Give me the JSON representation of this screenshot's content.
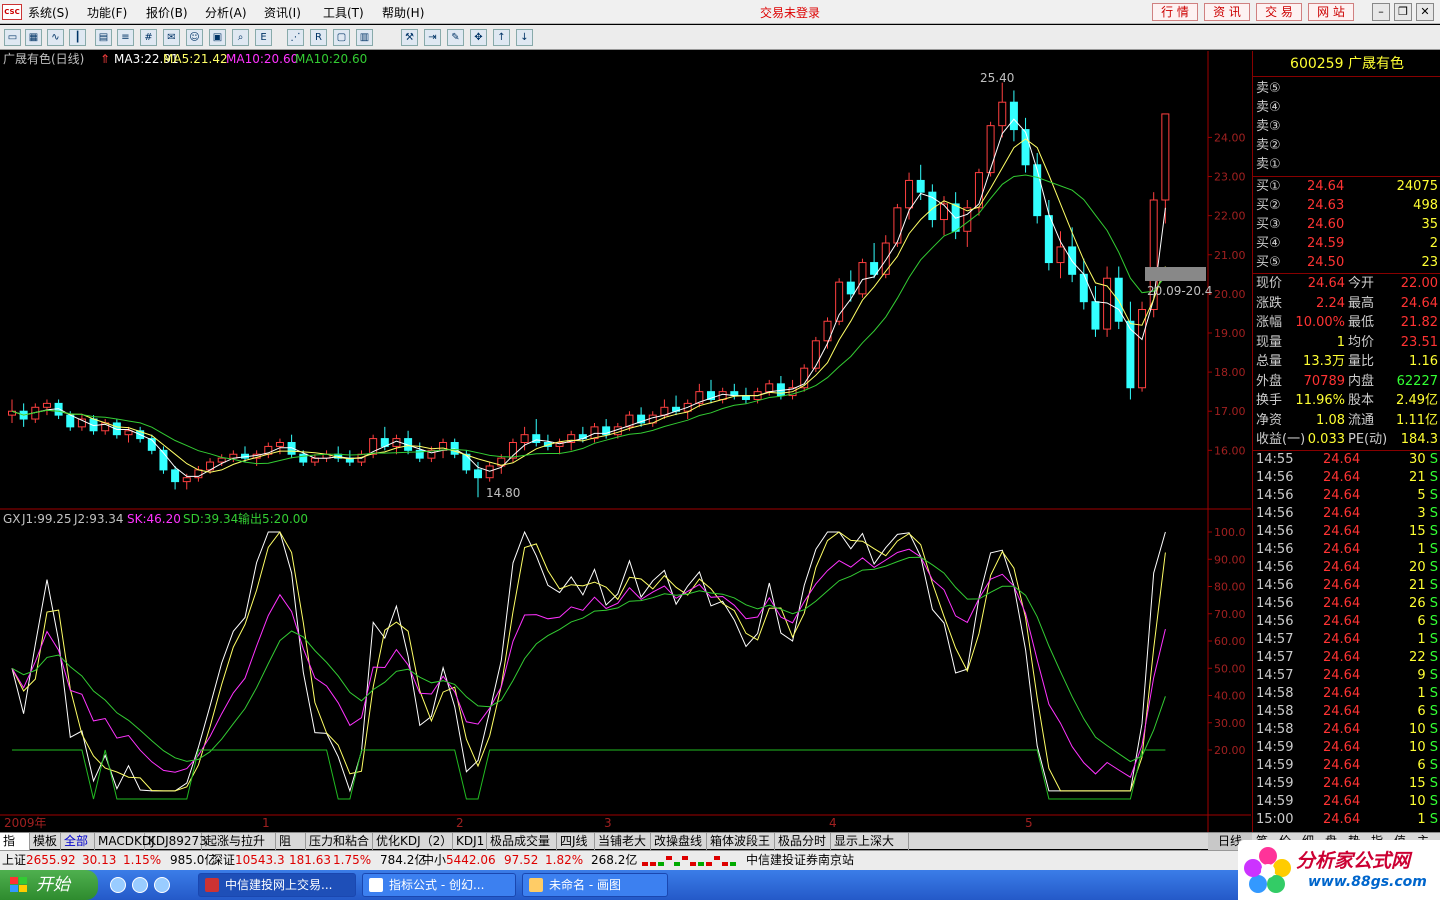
{
  "menu": {
    "logo": "CSC",
    "items": [
      "系统(S)",
      "功能(F)",
      "报价(B)",
      "分析(A)",
      "资讯(I)",
      "工具(T)",
      "帮助(H)"
    ],
    "center_title": "交易未登录",
    "right_buttons": [
      "行 情",
      "资 讯",
      "交 易",
      "网 站"
    ]
  },
  "main_chart": {
    "title": "广晟有色(日线)",
    "ma3": "MA3:22.91",
    "ma5": "MA5:21.42",
    "ma10a": "MA10:20.60",
    "ma10b": "MA10:20.60",
    "high_label": "25.40",
    "low_label": "14.80",
    "box_label": "20.09-20.4",
    "y_ticks": [
      "24.00",
      "23.00",
      "22.00",
      "21.00",
      "20.00",
      "19.00",
      "18.00",
      "17.00",
      "16.00"
    ],
    "colors": {
      "ma3": "#ffffff",
      "ma5": "#ffff66",
      "ma10a": "#ff33ff",
      "ma10b": "#33cc33",
      "up": "#ff4040",
      "down": "#33ffff"
    }
  },
  "sub_chart": {
    "title": "GX",
    "j1": "J1:99.25",
    "j2": "J2:93.34",
    "sk": "SK:46.20",
    "sd": "SD:39.34",
    "out": "输出5:20.00",
    "y_ticks": [
      "100.0",
      "90.00",
      "80.00",
      "70.00",
      "60.00",
      "50.00",
      "40.00",
      "30.00",
      "20.00"
    ]
  },
  "x_axis": {
    "labels": [
      "2009年",
      "1",
      "2",
      "3",
      "4",
      "5"
    ]
  },
  "chart_data": {
    "type": "candlestick",
    "title": "广晟有色(日线)",
    "ylim": [
      14.5,
      25.8
    ],
    "high": 25.4,
    "low": 14.8,
    "ohlc": [
      [
        16.9,
        17.3,
        16.7,
        17.0
      ],
      [
        17.0,
        17.2,
        16.6,
        16.8
      ],
      [
        16.8,
        17.2,
        16.7,
        17.1
      ],
      [
        17.1,
        17.3,
        16.9,
        17.2
      ],
      [
        17.2,
        17.3,
        16.8,
        16.9
      ],
      [
        16.9,
        17.0,
        16.5,
        16.6
      ],
      [
        16.6,
        16.9,
        16.5,
        16.8
      ],
      [
        16.8,
        16.9,
        16.4,
        16.5
      ],
      [
        16.5,
        16.8,
        16.4,
        16.7
      ],
      [
        16.7,
        16.8,
        16.3,
        16.4
      ],
      [
        16.4,
        16.6,
        16.2,
        16.5
      ],
      [
        16.5,
        16.6,
        16.2,
        16.3
      ],
      [
        16.3,
        16.4,
        15.9,
        16.0
      ],
      [
        16.0,
        16.1,
        15.4,
        15.5
      ],
      [
        15.5,
        15.6,
        15.0,
        15.2
      ],
      [
        15.2,
        15.4,
        15.0,
        15.3
      ],
      [
        15.3,
        15.6,
        15.2,
        15.5
      ],
      [
        15.5,
        15.8,
        15.4,
        15.7
      ],
      [
        15.7,
        15.9,
        15.6,
        15.8
      ],
      [
        15.8,
        16.0,
        15.7,
        15.9
      ],
      [
        15.9,
        16.1,
        15.7,
        15.8
      ],
      [
        15.8,
        16.0,
        15.6,
        15.9
      ],
      [
        15.9,
        16.2,
        15.8,
        16.1
      ],
      [
        16.1,
        16.3,
        15.9,
        16.2
      ],
      [
        16.2,
        16.4,
        15.8,
        15.9
      ],
      [
        15.9,
        16.0,
        15.6,
        15.7
      ],
      [
        15.7,
        15.9,
        15.6,
        15.8
      ],
      [
        15.8,
        16.0,
        15.7,
        15.9
      ],
      [
        15.9,
        16.1,
        15.7,
        15.8
      ],
      [
        15.8,
        16.0,
        15.6,
        15.7
      ],
      [
        15.7,
        16.0,
        15.6,
        15.9
      ],
      [
        15.9,
        16.4,
        15.8,
        16.3
      ],
      [
        16.3,
        16.6,
        16.0,
        16.1
      ],
      [
        16.1,
        16.4,
        15.9,
        16.3
      ],
      [
        16.3,
        16.5,
        15.9,
        16.0
      ],
      [
        16.0,
        16.2,
        15.7,
        15.8
      ],
      [
        15.8,
        16.1,
        15.7,
        16.0
      ],
      [
        16.0,
        16.3,
        15.8,
        16.2
      ],
      [
        16.2,
        16.3,
        15.8,
        15.9
      ],
      [
        15.9,
        16.0,
        15.4,
        15.5
      ],
      [
        15.5,
        15.7,
        14.8,
        15.3
      ],
      [
        15.3,
        15.7,
        15.2,
        15.6
      ],
      [
        15.6,
        15.9,
        15.4,
        15.8
      ],
      [
        15.8,
        16.3,
        15.7,
        16.2
      ],
      [
        16.2,
        16.6,
        16.0,
        16.4
      ],
      [
        16.4,
        16.8,
        16.1,
        16.2
      ],
      [
        16.2,
        16.4,
        16.0,
        16.1
      ],
      [
        16.1,
        16.3,
        15.9,
        16.2
      ],
      [
        16.2,
        16.5,
        16.0,
        16.4
      ],
      [
        16.4,
        16.6,
        16.2,
        16.3
      ],
      [
        16.3,
        16.7,
        16.2,
        16.6
      ],
      [
        16.6,
        16.8,
        16.3,
        16.4
      ],
      [
        16.4,
        16.7,
        16.3,
        16.6
      ],
      [
        16.6,
        17.0,
        16.5,
        16.9
      ],
      [
        16.9,
        17.1,
        16.6,
        16.7
      ],
      [
        16.7,
        17.0,
        16.6,
        16.9
      ],
      [
        16.9,
        17.3,
        16.8,
        17.1
      ],
      [
        17.1,
        17.4,
        16.9,
        17.0
      ],
      [
        17.0,
        17.3,
        16.8,
        17.2
      ],
      [
        17.2,
        17.7,
        17.1,
        17.5
      ],
      [
        17.5,
        17.8,
        17.2,
        17.3
      ],
      [
        17.3,
        17.6,
        17.2,
        17.5
      ],
      [
        17.5,
        17.7,
        17.3,
        17.4
      ],
      [
        17.4,
        17.6,
        17.2,
        17.3
      ],
      [
        17.3,
        17.6,
        17.2,
        17.5
      ],
      [
        17.5,
        17.8,
        17.4,
        17.7
      ],
      [
        17.7,
        17.9,
        17.3,
        17.4
      ],
      [
        17.4,
        17.8,
        17.3,
        17.6
      ],
      [
        17.6,
        18.2,
        17.5,
        18.1
      ],
      [
        18.1,
        18.9,
        18.0,
        18.8
      ],
      [
        18.8,
        19.4,
        18.6,
        19.3
      ],
      [
        19.3,
        20.4,
        19.2,
        20.3
      ],
      [
        20.3,
        20.6,
        19.8,
        20.0
      ],
      [
        20.0,
        20.9,
        19.9,
        20.8
      ],
      [
        20.8,
        21.3,
        20.4,
        20.5
      ],
      [
        20.5,
        21.5,
        20.4,
        21.3
      ],
      [
        21.3,
        22.3,
        21.2,
        22.2
      ],
      [
        22.2,
        23.1,
        21.9,
        22.9
      ],
      [
        22.9,
        23.3,
        22.4,
        22.6
      ],
      [
        22.6,
        22.8,
        21.7,
        21.9
      ],
      [
        21.9,
        22.5,
        21.5,
        22.3
      ],
      [
        22.3,
        22.6,
        21.4,
        21.6
      ],
      [
        21.6,
        22.4,
        21.2,
        22.2
      ],
      [
        22.2,
        23.2,
        22.0,
        23.1
      ],
      [
        23.1,
        24.4,
        23.0,
        24.3
      ],
      [
        24.3,
        25.4,
        24.0,
        24.9
      ],
      [
        24.9,
        25.2,
        23.9,
        24.2
      ],
      [
        24.2,
        24.5,
        23.1,
        23.3
      ],
      [
        23.3,
        23.6,
        21.8,
        22.0
      ],
      [
        22.0,
        22.4,
        20.6,
        20.8
      ],
      [
        20.8,
        21.6,
        20.4,
        21.2
      ],
      [
        21.2,
        21.7,
        20.3,
        20.5
      ],
      [
        20.5,
        20.9,
        19.6,
        19.8
      ],
      [
        19.8,
        20.2,
        18.9,
        19.1
      ],
      [
        19.1,
        20.7,
        18.9,
        20.4
      ],
      [
        20.4,
        20.7,
        19.1,
        19.3
      ],
      [
        19.3,
        19.8,
        17.3,
        17.6
      ],
      [
        17.6,
        19.8,
        17.5,
        19.6
      ],
      [
        19.6,
        22.6,
        19.4,
        22.4
      ],
      [
        22.4,
        24.6,
        21.8,
        24.6
      ]
    ]
  },
  "quote": {
    "code_name": "600259 广晟有色",
    "sell": [
      {
        "label": "卖⑤",
        "price": "",
        "vol": ""
      },
      {
        "label": "卖④",
        "price": "",
        "vol": ""
      },
      {
        "label": "卖③",
        "price": "",
        "vol": ""
      },
      {
        "label": "卖②",
        "price": "",
        "vol": ""
      },
      {
        "label": "卖①",
        "price": "",
        "vol": ""
      }
    ],
    "buy": [
      {
        "label": "买①",
        "price": "24.64",
        "vol": "24075"
      },
      {
        "label": "买②",
        "price": "24.63",
        "vol": "498"
      },
      {
        "label": "买③",
        "price": "24.60",
        "vol": "35"
      },
      {
        "label": "买④",
        "price": "24.59",
        "vol": "2"
      },
      {
        "label": "买⑤",
        "price": "24.50",
        "vol": "23"
      }
    ],
    "stats": [
      {
        "l1": "现价",
        "v1": "24.64",
        "c1": "#ff3333",
        "l2": "今开",
        "v2": "22.00",
        "c2": "#ff3333"
      },
      {
        "l1": "涨跌",
        "v1": "2.24",
        "c1": "#ff3333",
        "l2": "最高",
        "v2": "24.64",
        "c2": "#ff3333"
      },
      {
        "l1": "涨幅",
        "v1": "10.00%",
        "c1": "#ff3333",
        "l2": "最低",
        "v2": "21.82",
        "c2": "#ff3333"
      },
      {
        "l1": "现量",
        "v1": "1",
        "c1": "#ffff33",
        "l2": "均价",
        "v2": "23.51",
        "c2": "#ff3333"
      },
      {
        "l1": "总量",
        "v1": "13.3万",
        "c1": "#ffff33",
        "l2": "量比",
        "v2": "1.16",
        "c2": "#ffff33"
      },
      {
        "l1": "外盘",
        "v1": "70789",
        "c1": "#ff3333",
        "l2": "内盘",
        "v2": "62227",
        "c2": "#33ff33"
      },
      {
        "l1": "换手",
        "v1": "11.96%",
        "c1": "#ffff33",
        "l2": "股本",
        "v2": "2.49亿",
        "c2": "#ffff33"
      },
      {
        "l1": "净资",
        "v1": "1.08",
        "c1": "#ffff33",
        "l2": "流通",
        "v2": "1.11亿",
        "c2": "#ffff33"
      },
      {
        "l1": "收益(一)",
        "v1": "0.033",
        "c1": "#ffff33",
        "l2": "PE(动)",
        "v2": "184.3",
        "c2": "#ffff33"
      }
    ],
    "ticks": [
      {
        "t": "14:55",
        "p": "24.64",
        "v": "30",
        "d": "S"
      },
      {
        "t": "14:56",
        "p": "24.64",
        "v": "21",
        "d": "S"
      },
      {
        "t": "14:56",
        "p": "24.64",
        "v": "5",
        "d": "S"
      },
      {
        "t": "14:56",
        "p": "24.64",
        "v": "3",
        "d": "S"
      },
      {
        "t": "14:56",
        "p": "24.64",
        "v": "15",
        "d": "S"
      },
      {
        "t": "14:56",
        "p": "24.64",
        "v": "1",
        "d": "S"
      },
      {
        "t": "14:56",
        "p": "24.64",
        "v": "20",
        "d": "S"
      },
      {
        "t": "14:56",
        "p": "24.64",
        "v": "21",
        "d": "S"
      },
      {
        "t": "14:56",
        "p": "24.64",
        "v": "26",
        "d": "S"
      },
      {
        "t": "14:56",
        "p": "24.64",
        "v": "6",
        "d": "S"
      },
      {
        "t": "14:57",
        "p": "24.64",
        "v": "1",
        "d": "S"
      },
      {
        "t": "14:57",
        "p": "24.64",
        "v": "22",
        "d": "S"
      },
      {
        "t": "14:57",
        "p": "24.64",
        "v": "9",
        "d": "S"
      },
      {
        "t": "14:58",
        "p": "24.64",
        "v": "1",
        "d": "S"
      },
      {
        "t": "14:58",
        "p": "24.64",
        "v": "6",
        "d": "S"
      },
      {
        "t": "14:58",
        "p": "24.64",
        "v": "10",
        "d": "S"
      },
      {
        "t": "14:59",
        "p": "24.64",
        "v": "10",
        "d": "S"
      },
      {
        "t": "14:59",
        "p": "24.64",
        "v": "6",
        "d": "S"
      },
      {
        "t": "14:59",
        "p": "24.64",
        "v": "15",
        "d": "S"
      },
      {
        "t": "14:59",
        "p": "24.64",
        "v": "10",
        "d": "S"
      },
      {
        "t": "15:00",
        "p": "24.64",
        "v": "1",
        "d": "S"
      }
    ]
  },
  "bottom_tabs": [
    "指标",
    "模板",
    "全部",
    "MACDKDJ",
    "KDJ89273",
    "起涨与拉升2",
    "阻力",
    "压力和粘合",
    "优化KDJ（2）",
    "KDJ1",
    "极品成交量",
    "四J线",
    "当铺老大",
    "改操盘线",
    "箱体波段王",
    "极品分时",
    "显示上深大盘"
  ],
  "period": "日线",
  "right_tabs": [
    "笔",
    "价",
    "细",
    "盘",
    "势",
    "指",
    "值",
    "主"
  ],
  "status": {
    "sh_label": "上证",
    "sh_val": "2655.92",
    "sh_chg": "30.13",
    "sh_pct": "1.15%",
    "sh_amt": "985.0亿",
    "sz_label": "深证",
    "sz_val": "10543.3",
    "sz_chg": "181.63",
    "sz_pct": "1.75%",
    "sz_amt": "784.2亿",
    "zx_label": "中小",
    "zx_val": "5442.06",
    "zx_chg": "97.52",
    "zx_pct": "1.82%",
    "zx_amt": "268.2亿",
    "broker": "中信建投证券南京站"
  },
  "taskbar": {
    "start": "开始",
    "tasks": [
      "中信建投网上交易...",
      "指标公式 - 创幻...",
      "未命名 - 画图"
    ]
  },
  "brand": {
    "title": "分析家公式网",
    "url": "www.88gs.com"
  }
}
